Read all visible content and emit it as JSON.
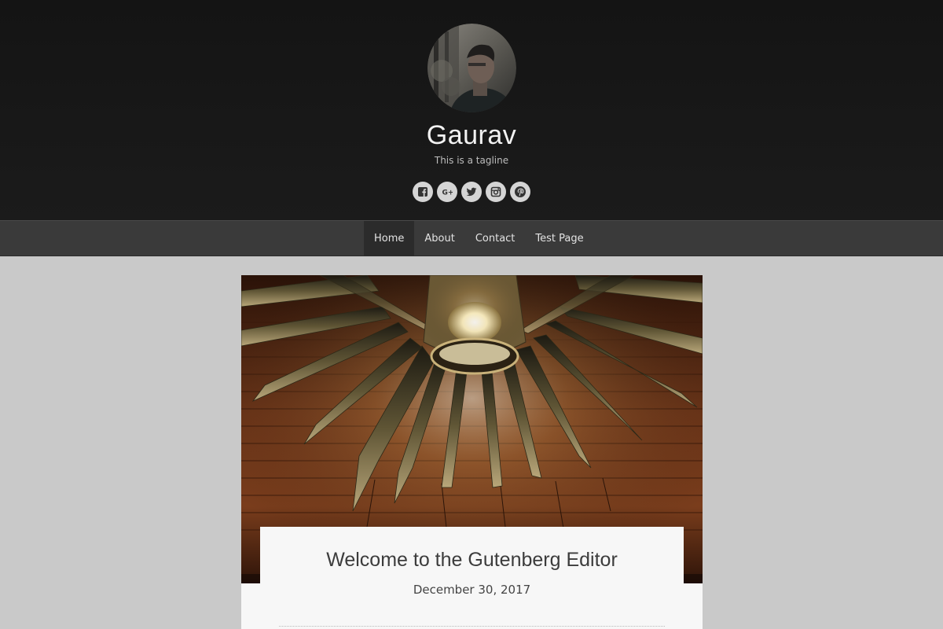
{
  "site": {
    "title": "Gaurav",
    "tagline": "This is a tagline"
  },
  "social": [
    {
      "name": "facebook-icon"
    },
    {
      "name": "google-plus-icon"
    },
    {
      "name": "twitter-icon"
    },
    {
      "name": "instagram-icon"
    },
    {
      "name": "pinterest-icon"
    }
  ],
  "nav": {
    "items": [
      {
        "label": "Home",
        "active": true
      },
      {
        "label": "About",
        "active": false
      },
      {
        "label": "Contact",
        "active": false
      },
      {
        "label": "Test Page",
        "active": false
      }
    ]
  },
  "post": {
    "title": "Welcome to the Gutenberg Editor",
    "date": "December 30, 2017"
  },
  "colors": {
    "header_bg": "#141414",
    "nav_bg": "#3a3a3a",
    "nav_active_bg": "#2b2b2b",
    "page_bg": "#c9c9c9",
    "card_bg": "#f7f7f7"
  }
}
